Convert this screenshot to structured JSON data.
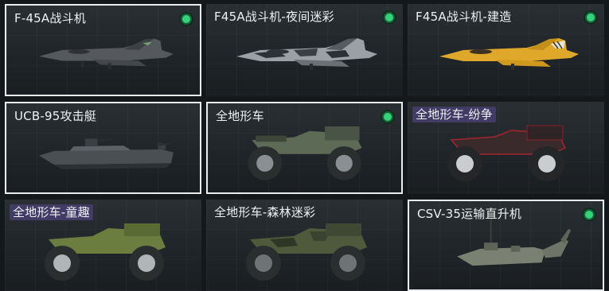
{
  "items": [
    {
      "title": "F-45A战斗机",
      "status_icon": "green-dot-icon",
      "selected": true
    },
    {
      "title": "F45A战斗机-夜间迷彩",
      "status_icon": "green-dot-icon",
      "selected": false
    },
    {
      "title": "F45A战斗机-建造",
      "status_icon": "green-dot-icon",
      "selected": false
    },
    {
      "title": "UCB-95攻击艇",
      "selected": true
    },
    {
      "title": "全地形车",
      "status_icon": "green-dot-icon",
      "selected": true
    },
    {
      "title": "全地形车-纷争",
      "selected": false
    },
    {
      "title": "全地形车-童趣",
      "selected": false
    },
    {
      "title": "全地形车-森林迷彩",
      "selected": false
    },
    {
      "title": "CSV-35运输直升机",
      "status_icon": "green-dot-icon",
      "selected": true
    }
  ],
  "colors": {
    "accent_green": "#34d27a",
    "selected_border": "#e9ecef",
    "tag_purple": "#463e6e"
  }
}
